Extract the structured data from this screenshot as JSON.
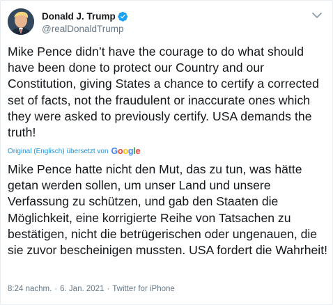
{
  "user": {
    "display_name": "Donald J. Trump",
    "handle": "@realDonaldTrump"
  },
  "tweet": {
    "text": "Mike Pence didn’t have the courage to do what should have been done to protect our Country and our Constitution, giving States a chance to certify a corrected set of facts, not the fraudulent or inaccurate ones which they were asked to previously certify. USA demands the truth!",
    "translation_note": "Original (Englisch) übersetzt von",
    "translation_provider": "Google",
    "translated_text": "Mike Pence hatte nicht den Mut, das zu tun, was hätte getan werden sollen, um unser Land und unsere Verfassung zu schützen, und gab den Staaten die Möglichkeit, eine korrigierte Reihe von Tatsachen zu bestätigen, nicht die betrügerischen oder ungenauen, die sie zuvor bescheinigen mussten. USA fordert die Wahrheit!",
    "time": "8:24 nachm.",
    "date": "6. Jan. 2021",
    "source": "Twitter for iPhone",
    "separator": "·"
  },
  "icons": {
    "verified": "verified-badge-icon",
    "more": "chevron-down-icon"
  },
  "colors": {
    "text": "#14171a",
    "secondary": "#657786",
    "link": "#1b95e0",
    "verified": "#1da1f2"
  }
}
